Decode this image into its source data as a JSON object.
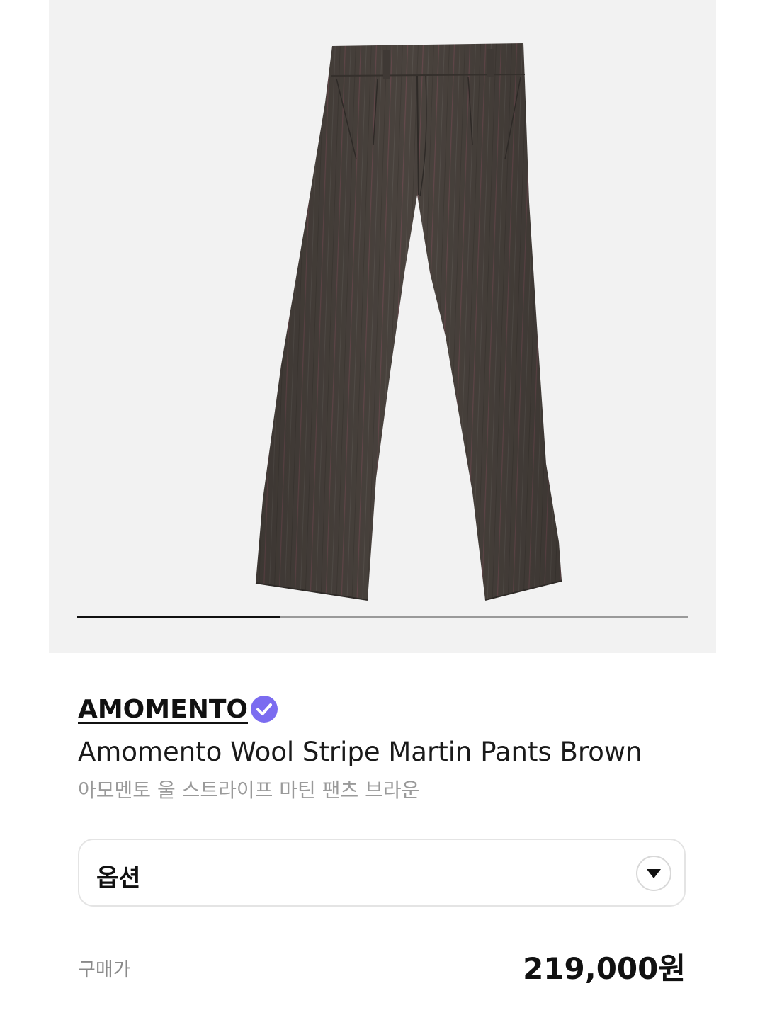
{
  "gallery": {
    "image_alt": "product-photo",
    "slide_progress": 0.333
  },
  "product": {
    "brand": "AMOMENTO",
    "brand_verified": true,
    "name_en": "Amomento Wool Stripe Martin Pants Brown",
    "name_ko": "아모멘토 울 스트라이프 마틴 팬츠 브라운"
  },
  "options": {
    "label": "옵션",
    "dropdown_icon": "caret-down-icon"
  },
  "price": {
    "label": "구매가",
    "value": "219,000원"
  },
  "colors": {
    "gallery_bg": "#f2f2f2",
    "accent_badge": "#7b6cf0",
    "pants_main": "#4a433e",
    "stripe": "#7a4a52"
  }
}
